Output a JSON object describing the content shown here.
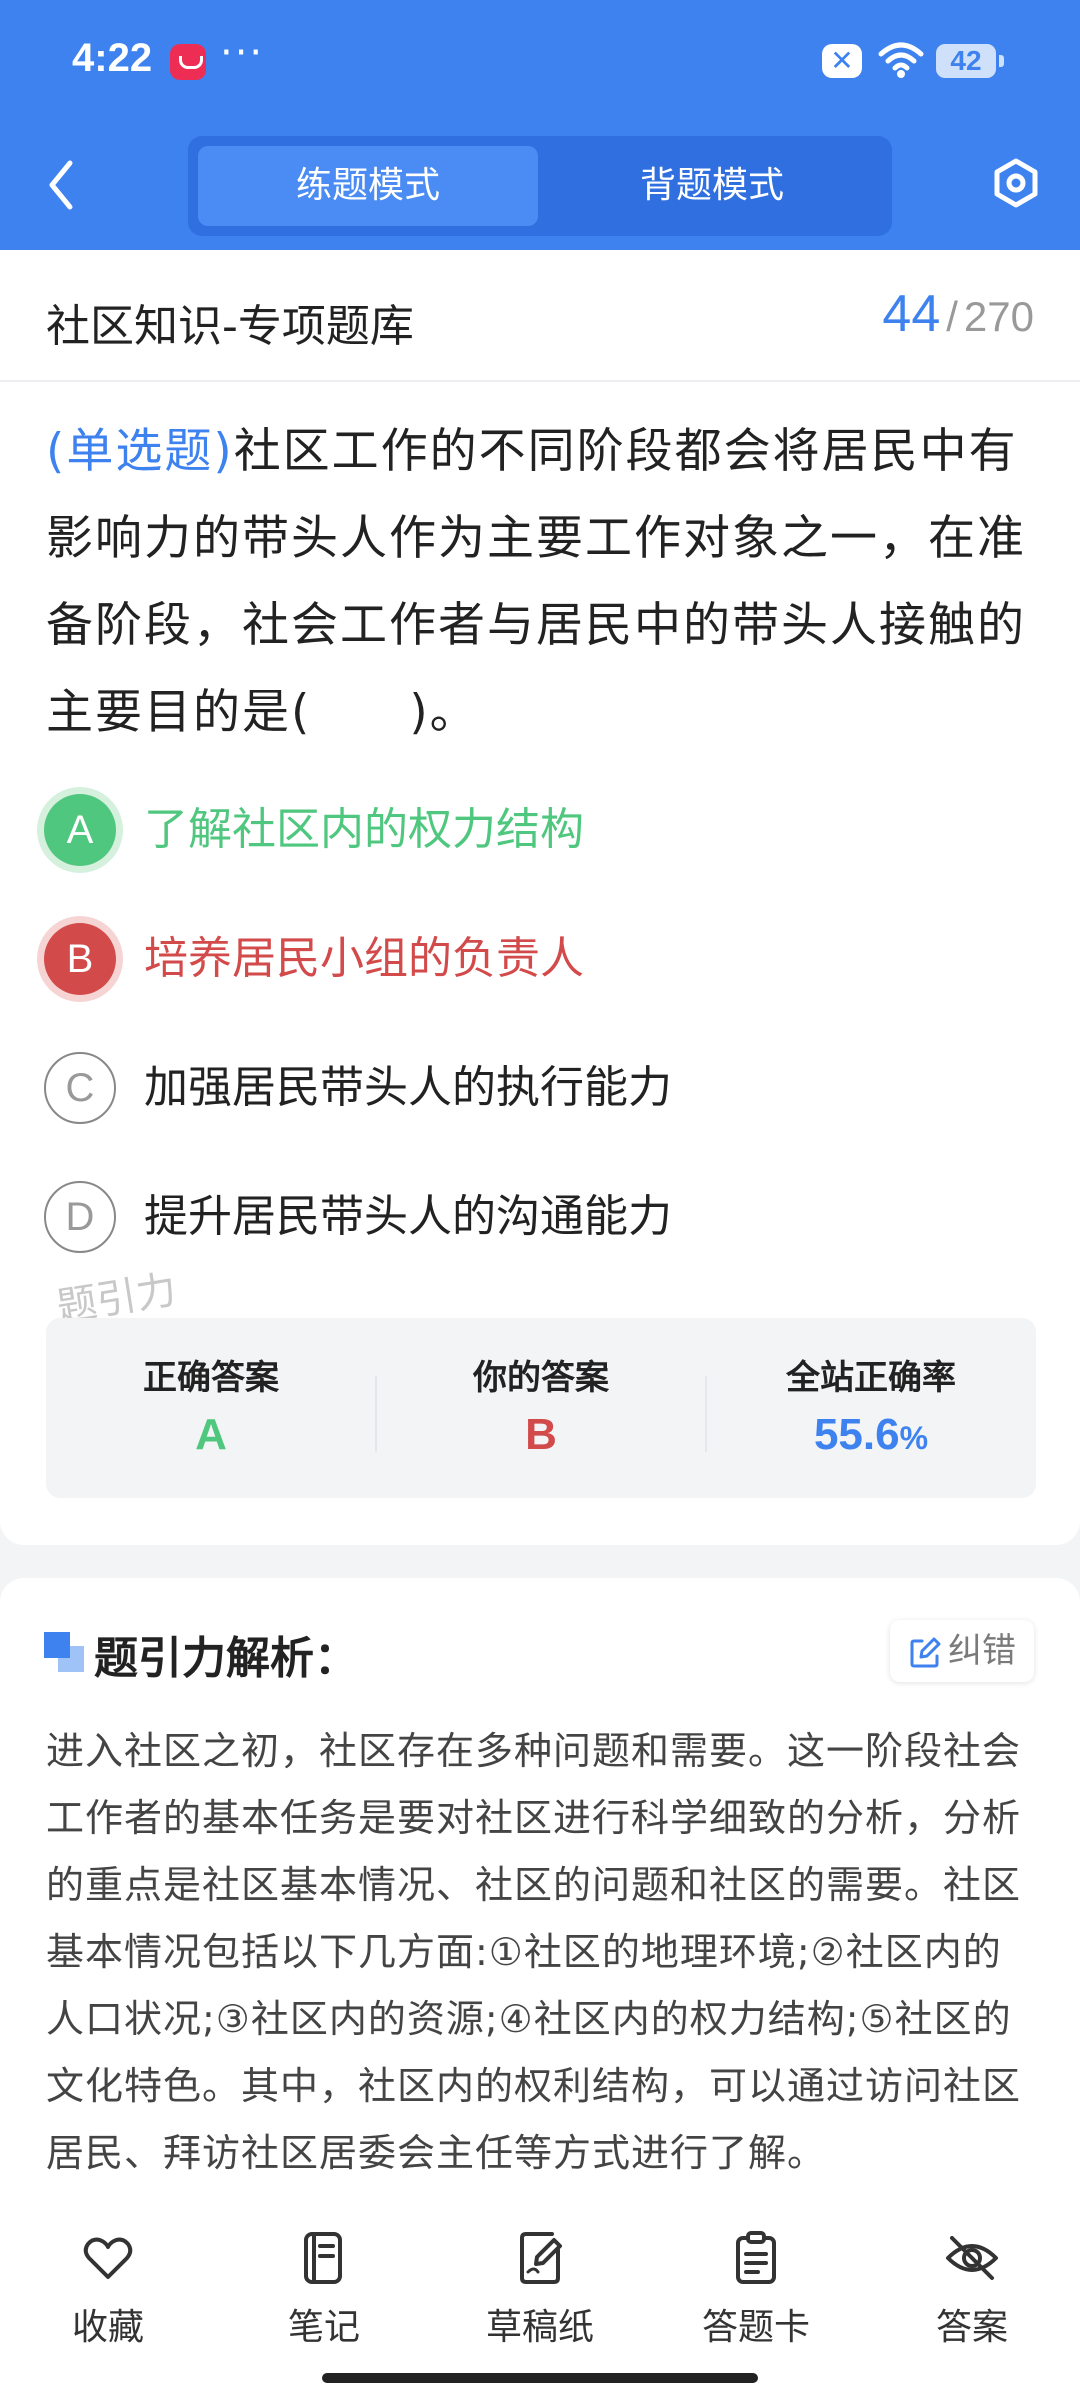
{
  "status_bar": {
    "time": "4:22",
    "dots": "···",
    "battery": "42"
  },
  "header": {
    "tabs": [
      {
        "label": "练题模式",
        "active": true
      },
      {
        "label": "背题模式",
        "active": false
      }
    ]
  },
  "bank": {
    "title": "社区知识-专项题库",
    "current": "44",
    "separator": "/",
    "total": "270"
  },
  "question": {
    "type": "(单选题)",
    "text": "社区工作的不同阶段都会将居民中有影响力的带头人作为主要工作对象之一，在准备阶段，社会工作者与居民中的带头人接触的主要目的是(　　)。",
    "options": [
      {
        "letter": "A",
        "text": "了解社区内的权力结构",
        "state": "correct"
      },
      {
        "letter": "B",
        "text": "培养居民小组的负责人",
        "state": "wrong"
      },
      {
        "letter": "C",
        "text": "加强居民带头人的执行能力",
        "state": "normal"
      },
      {
        "letter": "D",
        "text": "提升居民带头人的沟通能力",
        "state": "normal"
      }
    ]
  },
  "watermark": "题引力",
  "stats": {
    "correct_label": "正确答案",
    "correct_value": "A",
    "yours_label": "你的答案",
    "yours_value": "B",
    "rate_label": "全站正确率",
    "rate_value": "55.6",
    "rate_unit": "%"
  },
  "analysis": {
    "title": "题引力解析：",
    "report_label": "纠错",
    "text": "进入社区之初，社区存在多种问题和需要。这一阶段社会工作者的基本任务是要对社区进行科学细致的分析，分析的重点是社区基本情况、社区的问题和社区的需要。社区基本情况包括以下几方面:①社区的地理环境;②社区内的人口状况;③社区内的资源;④社区内的权力结构;⑤社区的文化特色。其中，社区内的权利结构，可以通过访问社区居民、拜访社区居委会主任等方式进行了解。"
  },
  "bottom_nav": [
    {
      "label": "收藏",
      "icon": "heart-icon"
    },
    {
      "label": "笔记",
      "icon": "notebook-icon"
    },
    {
      "label": "草稿纸",
      "icon": "draft-icon"
    },
    {
      "label": "答题卡",
      "icon": "answer-sheet-icon"
    },
    {
      "label": "答案",
      "icon": "eye-off-icon"
    }
  ],
  "colors": {
    "primary": "#3d82ee",
    "correct": "#4fc77e",
    "wrong": "#d24a4a"
  }
}
